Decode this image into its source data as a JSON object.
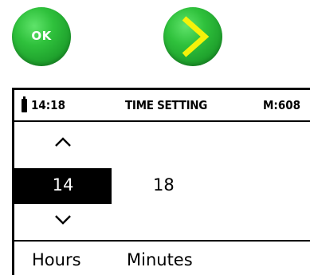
{
  "buttons": {
    "ok_label": "OK",
    "ok_color": "#2fc13c",
    "next_icon": "chevron-right-icon",
    "next_icon_color": "#f5f20a"
  },
  "status_bar": {
    "battery_icon": "battery-icon",
    "time": "14:18",
    "title": "TIME SETTING",
    "memory": "M:608"
  },
  "editor": {
    "up_icon": "chevron-up-icon",
    "down_icon": "chevron-down-icon",
    "hours_value": "14",
    "minutes_value": "18",
    "hours_label": "Hours",
    "minutes_label": "Minutes"
  }
}
